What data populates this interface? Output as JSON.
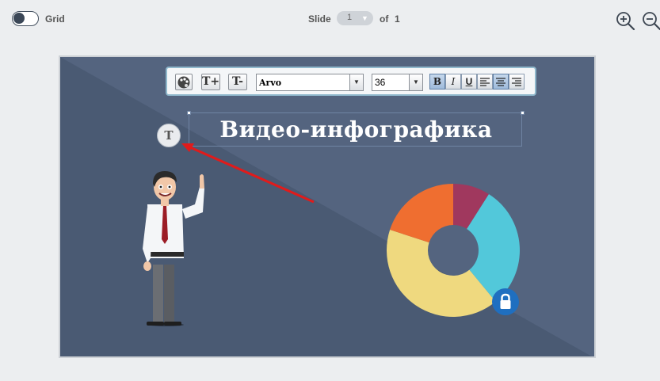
{
  "topbar": {
    "grid_label": "Grid",
    "grid_toggle_on": false,
    "slide_label": "Slide",
    "slide_current": "1",
    "of_label": "of",
    "slide_total": "1",
    "zoom_in_icon": "zoom-in-icon",
    "zoom_out_icon": "zoom-out-icon"
  },
  "toolbar": {
    "palette_icon": "palette-icon",
    "increase_font_label": "T+",
    "decrease_font_label": "T-",
    "font_family": "Arvo",
    "font_size": "36",
    "bold_label": "B",
    "italic_label": "I",
    "underline_label": "U",
    "bold_active": true,
    "align_center_active": true
  },
  "slide": {
    "title": "Видео-инфографика",
    "text_effect_label": "T",
    "lock_icon": "lock-icon",
    "background_color": "#4a5a73",
    "donut_colors": [
      "#a0385e",
      "#52c8da",
      "#efd97f",
      "#ef6e30"
    ],
    "donut_shares": [
      0.09,
      0.3,
      0.41,
      0.2
    ]
  }
}
